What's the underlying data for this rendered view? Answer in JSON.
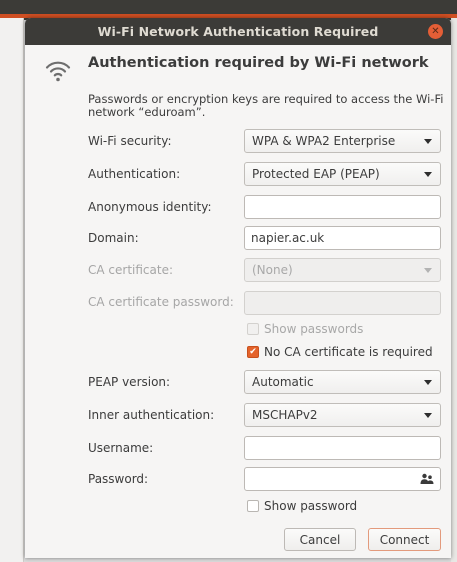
{
  "window": {
    "title": "Wi-Fi Network Authentication Required"
  },
  "icons": {
    "wifi": "wifi-icon",
    "close": "close-icon",
    "people": "people-icon",
    "checkmark": "checkmark-icon",
    "dropdown": "chevron-down-icon"
  },
  "colors": {
    "titlebar": "#3c3b38",
    "close_button": "#e45e36",
    "accent_check": "#e4632b",
    "dialog_bg": "#f6f5f4"
  },
  "dialog": {
    "heading": "Authentication required by Wi-Fi network",
    "description": "Passwords or encryption keys are required to access the Wi-Fi network “eduroam”.",
    "fields": {
      "wifi_security": {
        "label": "Wi-Fi security:",
        "value": "WPA & WPA2 Enterprise"
      },
      "authentication": {
        "label": "Authentication:",
        "value": "Protected EAP (PEAP)"
      },
      "anonymous_identity": {
        "label": "Anonymous identity:",
        "value": ""
      },
      "domain": {
        "label": "Domain:",
        "value": "napier.ac.uk"
      },
      "ca_certificate": {
        "label": "CA certificate:",
        "value": "(None)"
      },
      "ca_certificate_password": {
        "label": "CA certificate password:",
        "value": ""
      },
      "show_passwords": {
        "label": "Show passwords",
        "checked": false
      },
      "no_ca_required": {
        "label": "No CA certificate is required",
        "checked": true
      },
      "peap_version": {
        "label": "PEAP version:",
        "value": "Automatic"
      },
      "inner_authentication": {
        "label": "Inner authentication:",
        "value": "MSCHAPv2"
      },
      "username": {
        "label": "Username:",
        "value": ""
      },
      "password": {
        "label": "Password:",
        "value": ""
      },
      "show_password": {
        "label": "Show password",
        "checked": false
      }
    },
    "buttons": {
      "cancel": "Cancel",
      "connect": "Connect"
    }
  }
}
